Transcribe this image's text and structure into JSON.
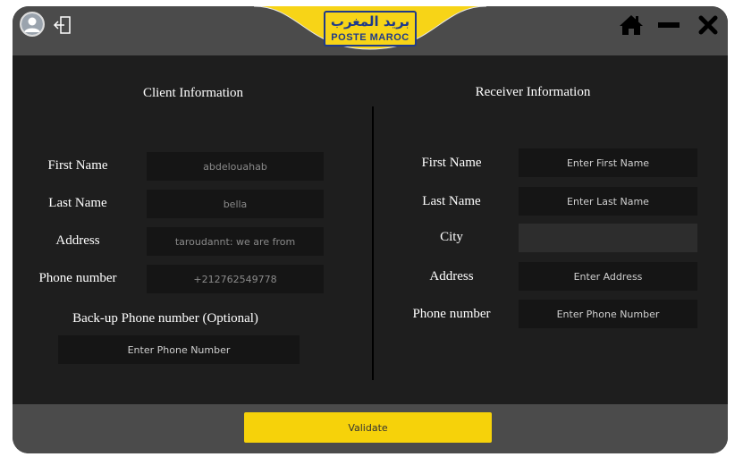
{
  "header": {
    "logo_arabic": "بريد المغرب",
    "logo_latin": "POSTE MAROC",
    "icons": [
      "user-avatar-icon",
      "logout-icon",
      "home-icon",
      "minimize-icon",
      "close-icon"
    ]
  },
  "client": {
    "title": "Client Information",
    "fields": [
      {
        "label": "First Name",
        "value": "abdelouahab"
      },
      {
        "label": "Last Name",
        "value": "bella"
      },
      {
        "label": "Address",
        "value": "taroudannt: we are from"
      },
      {
        "label": "Phone number",
        "value": "+212762549778"
      }
    ],
    "backup": {
      "label": "Back-up Phone number (Optional)",
      "placeholder": "Enter Phone Number"
    }
  },
  "receiver": {
    "title": "Receiver Information",
    "fields": [
      {
        "label": "First Name",
        "placeholder": "Enter First Name"
      },
      {
        "label": "Last Name",
        "placeholder": "Enter Last Name"
      },
      {
        "label": "City",
        "placeholder": ""
      },
      {
        "label": "Address",
        "placeholder": "Enter Address"
      },
      {
        "label": "Phone number",
        "placeholder": "Enter Phone Number"
      }
    ]
  },
  "footer": {
    "validate_label": "Validate"
  },
  "colors": {
    "accent": "#f6d20a",
    "background": "#1e1e1e",
    "bar": "#4b4b4b",
    "logo_blue": "#1f3a8a"
  }
}
